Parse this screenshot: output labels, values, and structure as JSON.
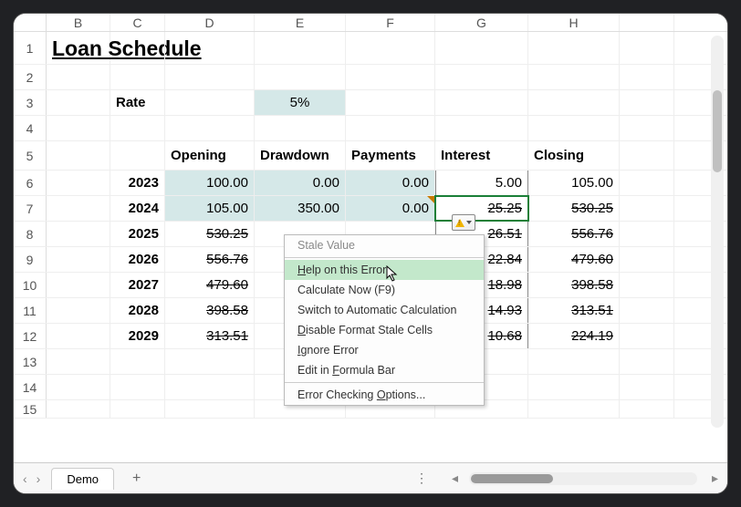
{
  "columns": [
    "B",
    "C",
    "D",
    "E",
    "F",
    "G",
    "H"
  ],
  "row_numbers": [
    "1",
    "2",
    "3",
    "4",
    "5",
    "6",
    "7",
    "8",
    "9",
    "10",
    "11",
    "12",
    "13",
    "14",
    "15"
  ],
  "title": "Loan Schedule",
  "rate_label": "Rate",
  "rate_value": "5%",
  "headers": {
    "opening": "Opening",
    "drawdown": "Drawdown",
    "payments": "Payments",
    "interest": "Interest",
    "closing": "Closing"
  },
  "rows": [
    {
      "year": "2023",
      "opening": "100.00",
      "drawdown": "0.00",
      "payments": "0.00",
      "interest": "5.00",
      "closing": "105.00",
      "strike": false,
      "fill": true
    },
    {
      "year": "2024",
      "opening": "105.00",
      "drawdown": "350.00",
      "payments": "0.00",
      "interest": "25.25",
      "closing": "530.25",
      "strike": true,
      "fill": true,
      "partial": true
    },
    {
      "year": "2025",
      "opening": "530.25",
      "drawdown": "",
      "payments": "",
      "interest": "26.51",
      "closing": "556.76",
      "strike": true
    },
    {
      "year": "2026",
      "opening": "556.76",
      "drawdown": "",
      "payments": "",
      "interest": "22.84",
      "closing": "479.60",
      "strike": true
    },
    {
      "year": "2027",
      "opening": "479.60",
      "drawdown": "",
      "payments": "",
      "interest": "18.98",
      "closing": "398.58",
      "strike": true
    },
    {
      "year": "2028",
      "opening": "398.58",
      "drawdown": "",
      "payments": "",
      "interest": "14.93",
      "closing": "313.51",
      "strike": true
    },
    {
      "year": "2029",
      "opening": "313.51",
      "drawdown": "",
      "payments": "",
      "interest": "10.68",
      "closing": "224.19",
      "strike": true
    }
  ],
  "context_menu": {
    "stale": "Stale Value",
    "help_prefix": "H",
    "help_rest": "elp on this Error",
    "calc": "Calculate Now (F9)",
    "switch": "Switch to Automatic Calculation",
    "disable_prefix": "D",
    "disable_rest": "isable Format Stale Cells",
    "ignore_prefix": "I",
    "ignore_rest": "gnore Error",
    "formula_prefix": "Edit in ",
    "formula_u": "F",
    "formula_rest": "ormula Bar",
    "options_prefix": "Error Checking ",
    "options_u": "O",
    "options_rest": "ptions..."
  },
  "tab_name": "Demo"
}
